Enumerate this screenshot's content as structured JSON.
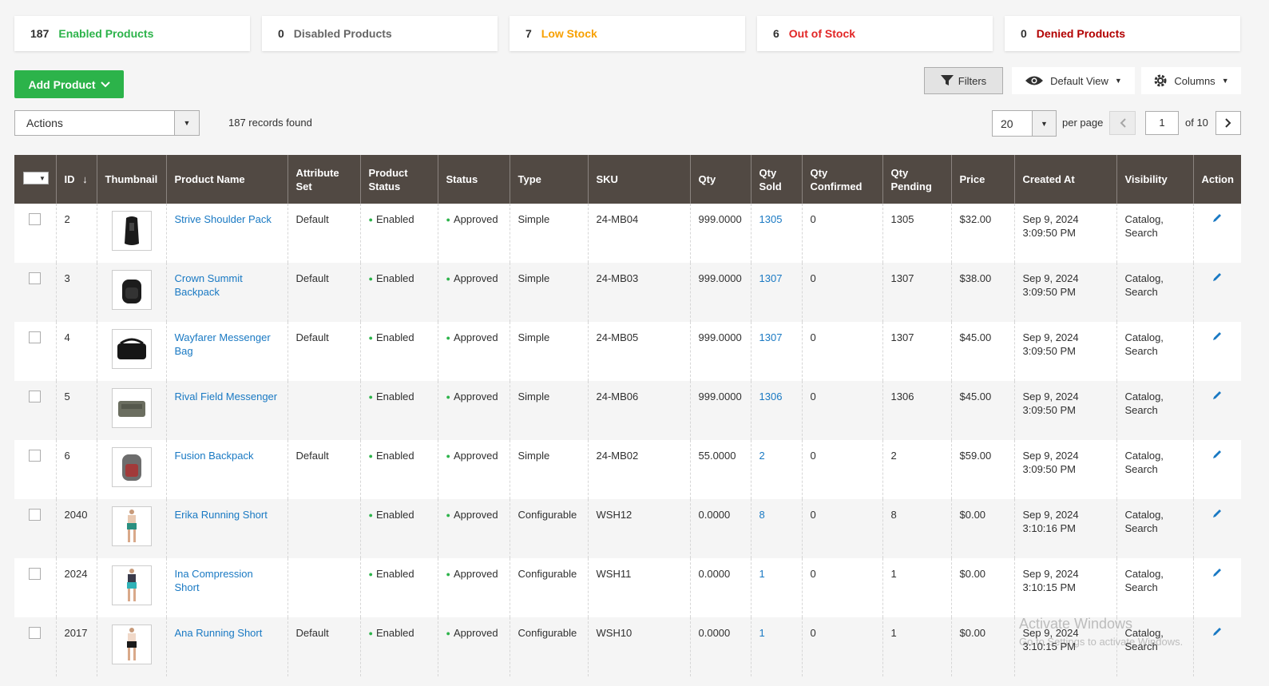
{
  "stats": [
    {
      "count": "187",
      "label": "Enabled Products",
      "color": "#2cb34a"
    },
    {
      "count": "0",
      "label": "Disabled Products",
      "color": "#666666"
    },
    {
      "count": "7",
      "label": "Low Stock",
      "color": "#f7a000"
    },
    {
      "count": "6",
      "label": "Out of Stock",
      "color": "#e22626"
    },
    {
      "count": "0",
      "label": "Denied Products",
      "color": "#b20000"
    }
  ],
  "toolbar": {
    "add_product": "Add Product",
    "filters": "Filters",
    "default_view": "Default View",
    "columns": "Columns",
    "actions": "Actions",
    "records_found": "187 records found",
    "per_page_value": "20",
    "per_page_label": "per page",
    "page_value": "1",
    "of_pages": "of 10"
  },
  "table": {
    "headers": [
      "ID",
      "Thumbnail",
      "Product Name",
      "Attribute Set",
      "Product Status",
      "Status",
      "Type",
      "SKU",
      "Qty",
      "Qty Sold",
      "Qty Confirmed",
      "Qty Pending",
      "Price",
      "Created At",
      "Visibility",
      "Action"
    ],
    "sort_icon": "arrow-down-icon",
    "rows": [
      {
        "id": "2",
        "thumb": "shoulder-pack",
        "name": "Strive Shoulder Pack",
        "attr": "Default",
        "pstatus": "Enabled",
        "status": "Approved",
        "type": "Simple",
        "sku": "24-MB04",
        "qty": "999.0000",
        "sold": "1305",
        "confirmed": "0",
        "pending": "1305",
        "price": "$32.00",
        "created1": "Sep 9, 2024",
        "created2": "3:09:50 PM",
        "vis1": "Catalog,",
        "vis2": "Search"
      },
      {
        "id": "3",
        "thumb": "backpack-black",
        "name": "Crown Summit Backpack",
        "attr": "Default",
        "pstatus": "Enabled",
        "status": "Approved",
        "type": "Simple",
        "sku": "24-MB03",
        "qty": "999.0000",
        "sold": "1307",
        "confirmed": "0",
        "pending": "1307",
        "price": "$38.00",
        "created1": "Sep 9, 2024",
        "created2": "3:09:50 PM",
        "vis1": "Catalog,",
        "vis2": "Search"
      },
      {
        "id": "4",
        "thumb": "messenger-bag",
        "name": "Wayfarer Messenger Bag",
        "attr": "Default",
        "pstatus": "Enabled",
        "status": "Approved",
        "type": "Simple",
        "sku": "24-MB05",
        "qty": "999.0000",
        "sold": "1307",
        "confirmed": "0",
        "pending": "1307",
        "price": "$45.00",
        "created1": "Sep 9, 2024",
        "created2": "3:09:50 PM",
        "vis1": "Catalog,",
        "vis2": "Search"
      },
      {
        "id": "5",
        "thumb": "field-messenger",
        "name": "Rival Field Messenger",
        "attr": "",
        "pstatus": "Enabled",
        "status": "Approved",
        "type": "Simple",
        "sku": "24-MB06",
        "qty": "999.0000",
        "sold": "1306",
        "confirmed": "0",
        "pending": "1306",
        "price": "$45.00",
        "created1": "Sep 9, 2024",
        "created2": "3:09:50 PM",
        "vis1": "Catalog,",
        "vis2": "Search"
      },
      {
        "id": "6",
        "thumb": "backpack-grey",
        "name": "Fusion Backpack",
        "attr": "Default",
        "pstatus": "Enabled",
        "status": "Approved",
        "type": "Simple",
        "sku": "24-MB02",
        "qty": "55.0000",
        "sold": "2",
        "confirmed": "0",
        "pending": "2",
        "price": "$59.00",
        "created1": "Sep 9, 2024",
        "created2": "3:09:50 PM",
        "vis1": "Catalog,",
        "vis2": "Search"
      },
      {
        "id": "2040",
        "thumb": "short-green",
        "name": "Erika Running Short",
        "attr": "",
        "pstatus": "Enabled",
        "status": "Approved",
        "type": "Configurable",
        "sku": "WSH12",
        "qty": "0.0000",
        "sold": "8",
        "confirmed": "0",
        "pending": "8",
        "price": "$0.00",
        "created1": "Sep 9, 2024",
        "created2": "3:10:16 PM",
        "vis1": "Catalog,",
        "vis2": "Search"
      },
      {
        "id": "2024",
        "thumb": "short-teal",
        "name": "Ina Compression Short",
        "attr": "",
        "pstatus": "Enabled",
        "status": "Approved",
        "type": "Configurable",
        "sku": "WSH11",
        "qty": "0.0000",
        "sold": "1",
        "confirmed": "0",
        "pending": "1",
        "price": "$0.00",
        "created1": "Sep 9, 2024",
        "created2": "3:10:15 PM",
        "vis1": "Catalog,",
        "vis2": "Search"
      },
      {
        "id": "2017",
        "thumb": "short-black",
        "name": "Ana Running Short",
        "attr": "Default",
        "pstatus": "Enabled",
        "status": "Approved",
        "type": "Configurable",
        "sku": "WSH10",
        "qty": "0.0000",
        "sold": "1",
        "confirmed": "0",
        "pending": "1",
        "price": "$0.00",
        "created1": "Sep 9, 2024",
        "created2": "3:10:15 PM",
        "vis1": "Catalog,",
        "vis2": "Search"
      }
    ]
  },
  "watermark": {
    "line1": "Activate Windows",
    "line2": "Go to Settings to activate Windows."
  },
  "colors": {
    "header_bg": "#514943",
    "link": "#1979c3",
    "success": "#2cb34a"
  }
}
